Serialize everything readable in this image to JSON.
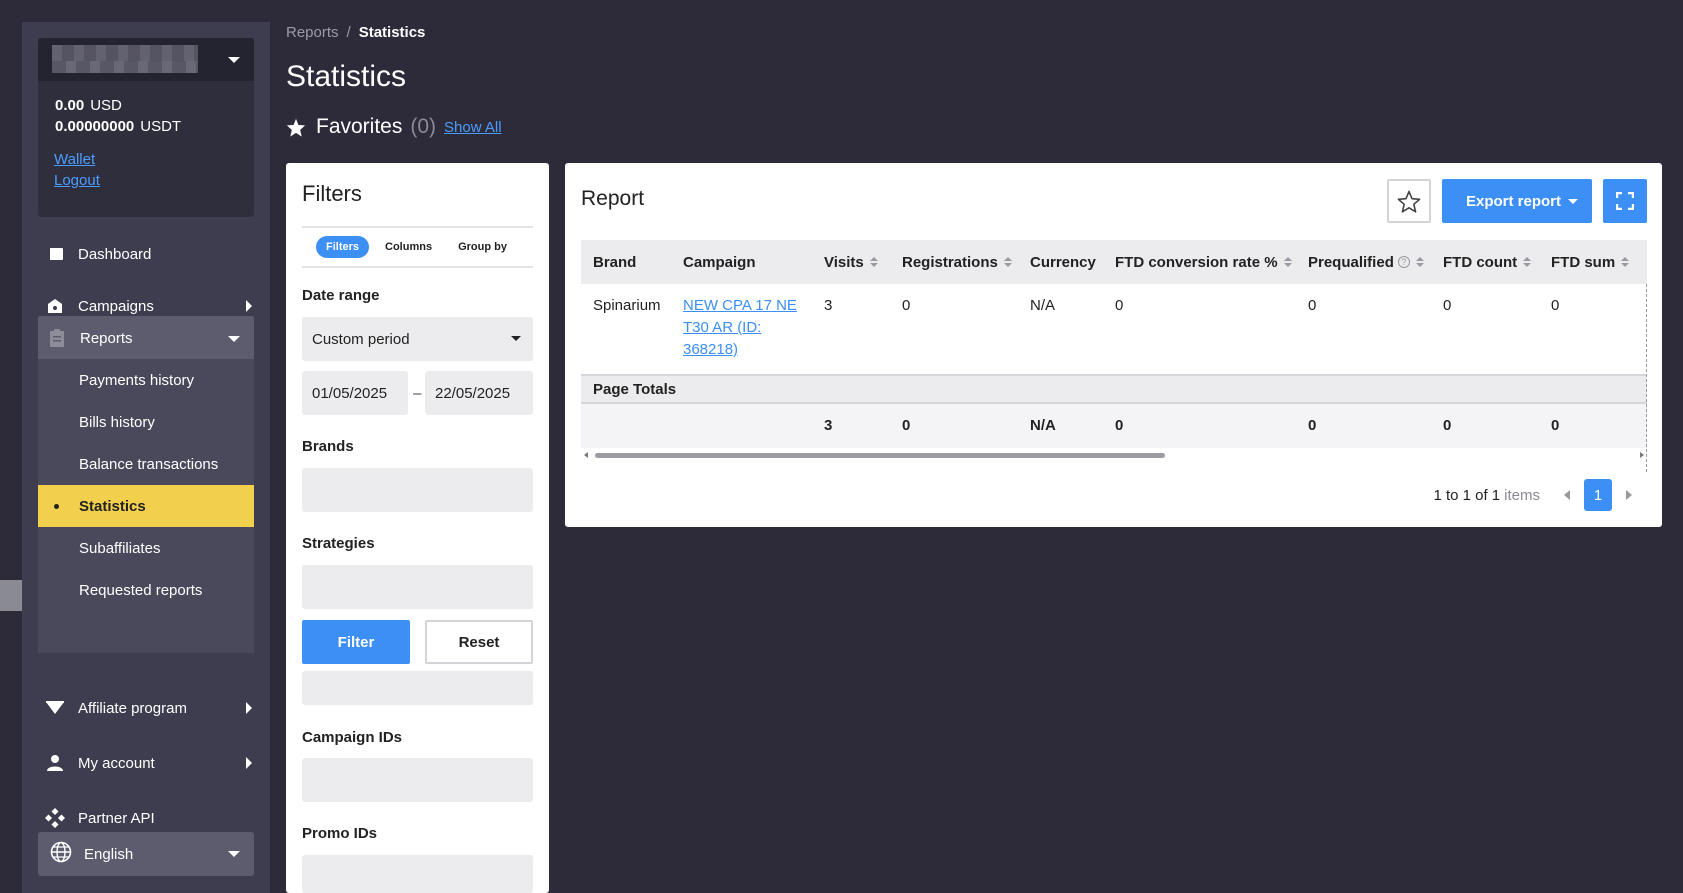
{
  "account": {
    "balances": [
      {
        "amount": "0.00",
        "currency": "USD"
      },
      {
        "amount": "0.00000000",
        "currency": "USDT"
      }
    ],
    "wallet_label": "Wallet",
    "logout_label": "Logout"
  },
  "nav": {
    "dashboard": "Dashboard",
    "campaigns": "Campaigns",
    "reports": "Reports",
    "sub": [
      "Payments history",
      "Bills history",
      "Balance transactions",
      "Statistics",
      "Subaffiliates",
      "Requested reports"
    ],
    "affiliate_program": "Affiliate program",
    "my_account": "My account",
    "partner_api": "Partner API",
    "language": "English"
  },
  "breadcrumb": {
    "parent": "Reports",
    "sep": "/",
    "current": "Statistics"
  },
  "page_title": "Statistics",
  "favorites": {
    "label": "Favorites",
    "count": "(0)",
    "show_all": "Show All"
  },
  "filters": {
    "title": "Filters",
    "tabs": [
      "Filters",
      "Columns",
      "Group by"
    ],
    "date_range_label": "Date range",
    "date_range_value": "Custom period",
    "date_from": "01/05/2025",
    "date_sep": "–",
    "date_to": "22/05/2025",
    "brands_label": "Brands",
    "strategies_label": "Strategies",
    "filter_button": "Filter",
    "reset_button": "Reset",
    "campaign_ids_label": "Campaign IDs",
    "promo_ids_label": "Promo IDs"
  },
  "report": {
    "title": "Report",
    "export_label": "Export report",
    "columns": [
      "Brand",
      "Campaign",
      "Visits",
      "Registrations",
      "Currency",
      "FTD conversion rate %",
      "Prequalified",
      "FTD count",
      "FTD sum"
    ],
    "rows": [
      {
        "brand": "Spinarium",
        "campaign": "NEW CPA 17 NE T30 AR (ID: 368218)",
        "visits": "3",
        "registrations": "0",
        "currency": "N/A",
        "ftd_rate": "0",
        "prequalified": "0",
        "ftd_count": "0",
        "ftd_sum": "0"
      }
    ],
    "totals_label": "Page Totals",
    "totals": {
      "visits": "3",
      "registrations": "0",
      "currency": "N/A",
      "ftd_rate": "0",
      "prequalified": "0",
      "ftd_count": "0",
      "ftd_sum": "0"
    },
    "pager": {
      "range": "1 to 1 of 1",
      "items_label": "items",
      "page": "1"
    }
  },
  "colors": {
    "accent": "#3b8ff5",
    "active_nav": "#f2d04d",
    "background": "#2d2b3a",
    "sidebar": "#3e3d4f"
  }
}
